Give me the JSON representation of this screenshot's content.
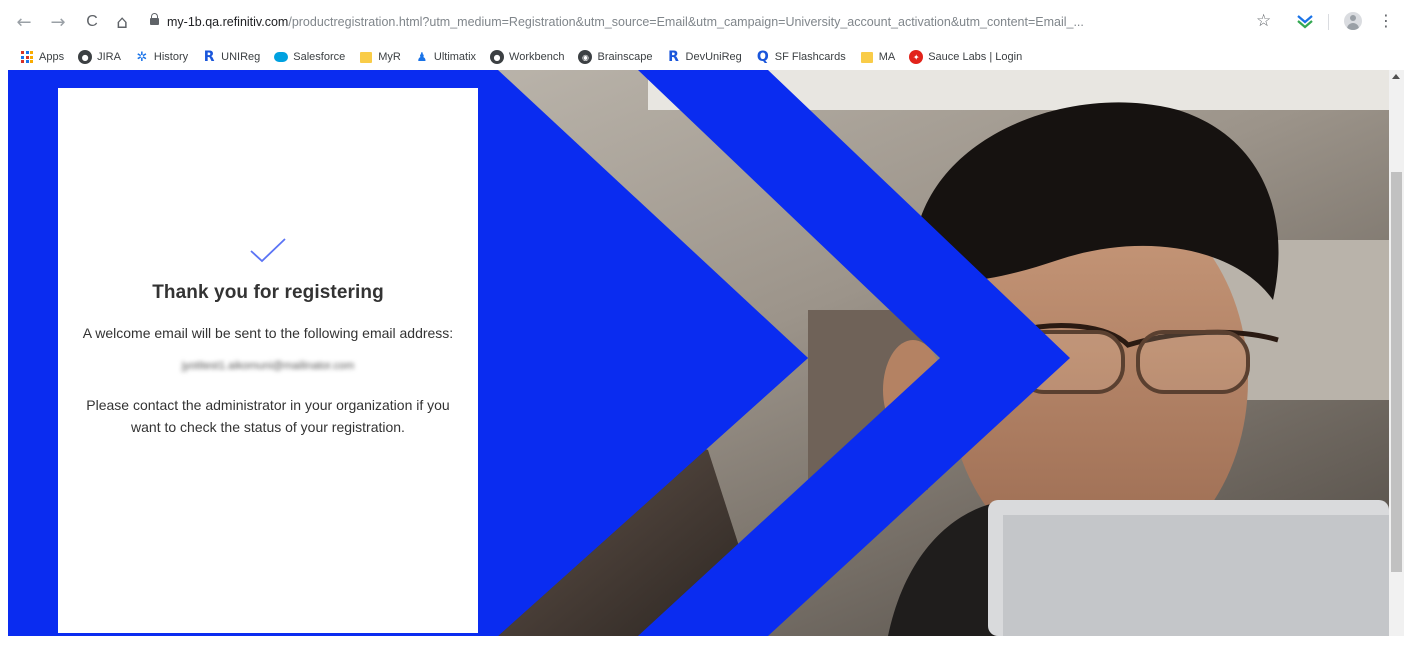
{
  "browser": {
    "url_host": "my-1b.qa.refinitiv.com",
    "url_path": "/productregistration.html?utm_medium=Registration&utm_source=Email&utm_campaign=University_account_activation&utm_content=Email_...",
    "back_icon": "←",
    "forward_icon": "→",
    "reload_icon": "C",
    "home_icon": "⌂",
    "star_icon": "☆",
    "menu_icon": "⋮"
  },
  "bookmarks": [
    {
      "label": "Apps",
      "icon": "apps-grid-icon"
    },
    {
      "label": "JIRA",
      "icon": "globe-icon"
    },
    {
      "label": "History",
      "icon": "gear-icon"
    },
    {
      "label": "UNIReg",
      "icon": "refinitiv-icon"
    },
    {
      "label": "Salesforce",
      "icon": "salesforce-cloud-icon"
    },
    {
      "label": "MyR",
      "icon": "folder-icon"
    },
    {
      "label": "Ultimatix",
      "icon": "ultimatix-icon"
    },
    {
      "label": "Workbench",
      "icon": "globe-icon"
    },
    {
      "label": "Brainscape",
      "icon": "brainscape-icon"
    },
    {
      "label": "DevUniReg",
      "icon": "refinitiv-icon"
    },
    {
      "label": "SF Flashcards",
      "icon": "quizlet-icon"
    },
    {
      "label": "MA",
      "icon": "folder-icon"
    },
    {
      "label": "Sauce Labs | Login",
      "icon": "sauce-labs-icon"
    }
  ],
  "card": {
    "title": "Thank you for registering",
    "message": "A welcome email will be sent to the following email address:",
    "email": "jyotitest1.aikomuni@mailinator.com",
    "contact": "Please contact the administrator in your organization if you want to check the status of your registration."
  },
  "colors": {
    "brand_blue": "#0a2cf0",
    "check_color": "#5b74f5"
  }
}
